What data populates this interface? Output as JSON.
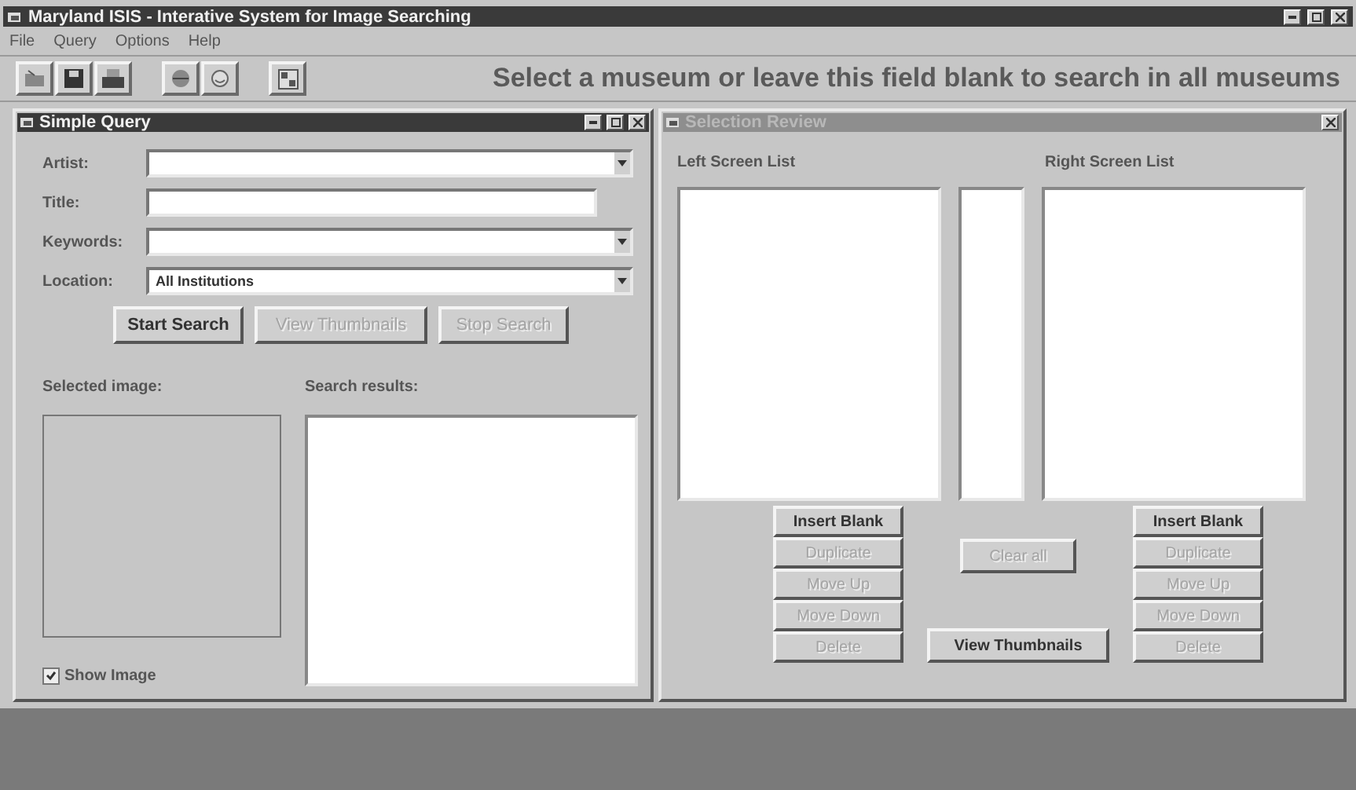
{
  "window": {
    "title": "Maryland ISIS - Interative System for Image Searching"
  },
  "menu": [
    "File",
    "Query",
    "Options",
    "Help"
  ],
  "toolbar": {
    "hint": "Select a museum or leave this field blank to search in all museums"
  },
  "simple_query": {
    "title": "Simple Query",
    "active": true,
    "fields": [
      {
        "label": "Artist:",
        "kind": "combo"
      },
      {
        "label": "Title:",
        "kind": "text"
      },
      {
        "label": "Keywords:",
        "kind": "combo"
      },
      {
        "label": "Location:",
        "kind": "combo",
        "value": "All Institutions"
      }
    ],
    "buttons": [
      {
        "label": "Start Search",
        "disabled": false
      },
      {
        "label": "View Thumbnails",
        "disabled": true
      },
      {
        "label": "Stop Search",
        "disabled": true
      }
    ],
    "selected_image_label": "Selected image:",
    "search_results_label": "Search results:",
    "show_image": {
      "label": "Show  Image",
      "checked": true
    }
  },
  "selection_review": {
    "title": "Selection Review",
    "active": false,
    "left_label": "Left Screen List",
    "right_label": "Right Screen List",
    "left_buttons": [
      {
        "label": "Insert Blank",
        "disabled": false
      },
      {
        "label": "Duplicate",
        "disabled": true
      },
      {
        "label": "Move Up",
        "disabled": true
      },
      {
        "label": "Move Down",
        "disabled": true
      },
      {
        "label": "Delete",
        "disabled": true
      }
    ],
    "clear_button": {
      "label": "Clear all",
      "disabled": true
    },
    "thumbnails_button": {
      "label": "View Thumbnails",
      "disabled": false
    },
    "right_buttons": [
      {
        "label": "Insert Blank",
        "disabled": false
      },
      {
        "label": "Duplicate",
        "disabled": true
      },
      {
        "label": "Move Up",
        "disabled": true
      },
      {
        "label": "Move Down",
        "disabled": true
      },
      {
        "label": "Delete",
        "disabled": true
      }
    ]
  }
}
